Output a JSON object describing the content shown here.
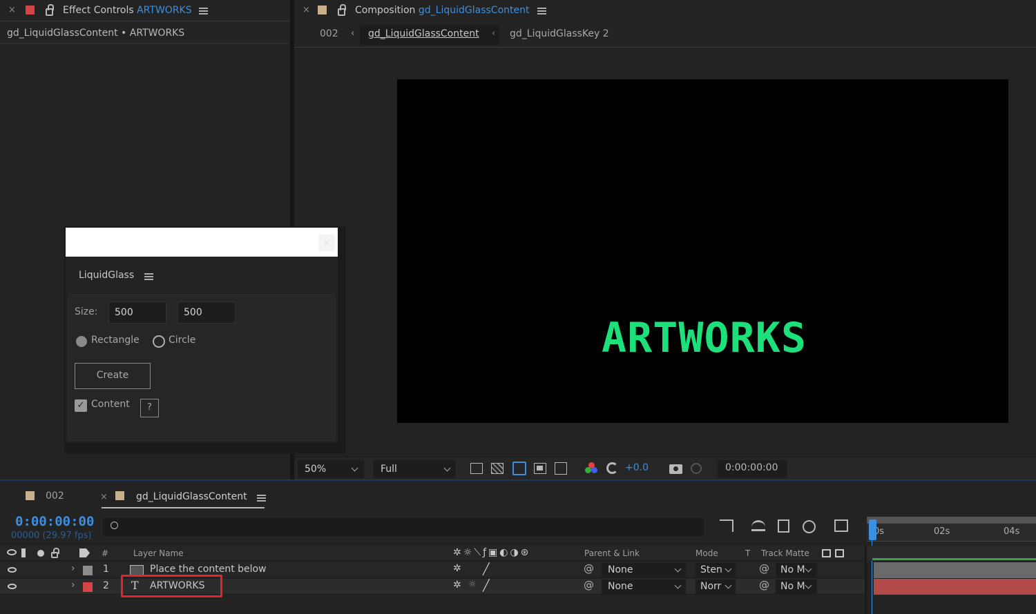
{
  "effect_controls": {
    "close": "×",
    "title_prefix": "Effect Controls",
    "title_layer": "ARTWORKS",
    "subtitle": "gd_LiquidGlassContent • ARTWORKS"
  },
  "composition_panel": {
    "close": "×",
    "title_prefix": "Composition",
    "title_comp": "gd_LiquidGlassContent",
    "breadcrumb": [
      "002",
      "gd_LiquidGlassContent",
      "gd_LiquidGlassKey 2"
    ],
    "viewer_text": "ARTWORKS",
    "viewer_text_color": "#1ee07a",
    "zoom": "50%",
    "resolution": "Full",
    "exposure": "+0.0",
    "timecode": "0:00:00:00"
  },
  "liquidglass_panel": {
    "title": "LiquidGlass",
    "size_label": "Size:",
    "width": "500",
    "height": "500",
    "shape_options": [
      "Rectangle",
      "Circle"
    ],
    "create_button": "Create",
    "content_label": "Content",
    "help_button": "?",
    "close": "×"
  },
  "timeline": {
    "tabs": [
      "002",
      "gd_LiquidGlassContent"
    ],
    "tab_close": "×",
    "current_time": "0:00:00:00",
    "frame_info": "00000 (29.97 fps)",
    "columns": {
      "num": "#",
      "layer_name": "Layer Name",
      "parent_link": "Parent & Link",
      "mode": "Mode",
      "t": "T",
      "track_matte": "Track Matte"
    },
    "ruler": [
      "0s",
      "02s",
      "04s"
    ],
    "layers": [
      {
        "num": "1",
        "name": "Place the content below",
        "type": "image",
        "label_color": "#8c8c8c",
        "parent": "None",
        "mode": "Sten",
        "matte": "No M",
        "bar_color": "#6a6a6a"
      },
      {
        "num": "2",
        "name": "ARTWORKS",
        "type": "T",
        "label_color": "#d64545",
        "parent": "None",
        "mode": "Norr",
        "matte": "No M",
        "bar_color": "#b24a4a"
      }
    ]
  },
  "colors": {
    "accent_blue": "#3d8fe0",
    "highlight_red": "#e8222a",
    "bg": "#232323"
  }
}
